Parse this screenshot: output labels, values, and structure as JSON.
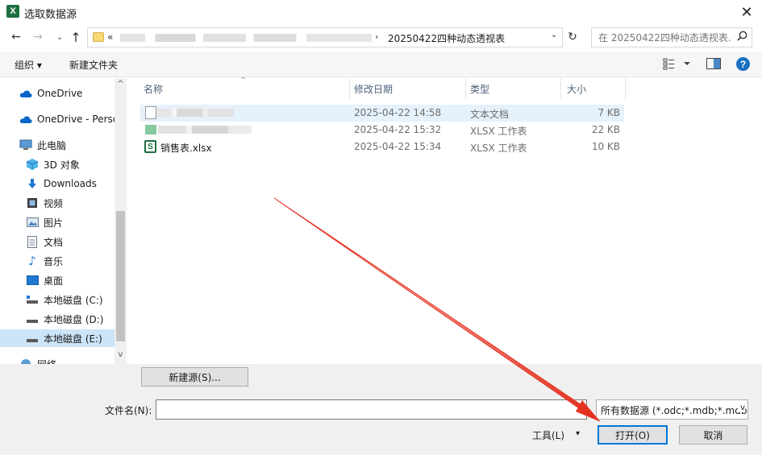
{
  "window": {
    "app_icon": "X",
    "title": "选取数据源",
    "close": "✕"
  },
  "address": {
    "prefix": "«",
    "current": "20250422四种动态透视表",
    "search_placeholder": "在 20250422四种动态透视表..."
  },
  "toolbar": {
    "organize": "组织 ▾",
    "new_folder": "新建文件夹",
    "help": "?"
  },
  "nav": {
    "items": [
      {
        "label": "OneDrive",
        "icon": "cloud-icon"
      },
      {
        "label": "OneDrive - Perso",
        "icon": "cloud-icon"
      },
      {
        "label": "此电脑",
        "icon": "computer-icon"
      },
      {
        "label": "3D 对象",
        "icon": "cube-icon"
      },
      {
        "label": "Downloads",
        "icon": "download-icon"
      },
      {
        "label": "视频",
        "icon": "video-icon"
      },
      {
        "label": "图片",
        "icon": "picture-icon"
      },
      {
        "label": "文档",
        "icon": "document-icon"
      },
      {
        "label": "音乐",
        "icon": "music-icon"
      },
      {
        "label": "桌面",
        "icon": "desktop-icon"
      },
      {
        "label": "本地磁盘 (C:)",
        "icon": "drive-icon"
      },
      {
        "label": "本地磁盘 (D:)",
        "icon": "drive-icon"
      },
      {
        "label": "本地磁盘 (E:)",
        "icon": "drive-icon"
      },
      {
        "label": "网络",
        "icon": "network-icon"
      }
    ]
  },
  "files": {
    "columns": {
      "name": "名称",
      "date": "修改日期",
      "type": "类型",
      "size": "大小"
    },
    "rows": [
      {
        "date": "2025-04-22 14:58",
        "type": "文本文档",
        "size": "7 KB"
      },
      {
        "date": "2025-04-22 15:32",
        "type": "XLSX 工作表",
        "size": "22 KB"
      },
      {
        "name": "销售表.xlsx",
        "date": "2025-04-22 15:34",
        "type": "XLSX 工作表",
        "size": "10 KB"
      }
    ]
  },
  "footer": {
    "new_source": "新建源(S)...",
    "filename_label": "文件名(N):",
    "filename_value": "",
    "filetype": "所有数据源 (*.odc;*.mdb;*.mdb",
    "tools": "工具(L)",
    "open": "打开(O)",
    "cancel": "取消"
  },
  "colors": {
    "accent": "#0078d7",
    "selected": "#cce4f7",
    "annotation_arrow": "#e53322"
  }
}
